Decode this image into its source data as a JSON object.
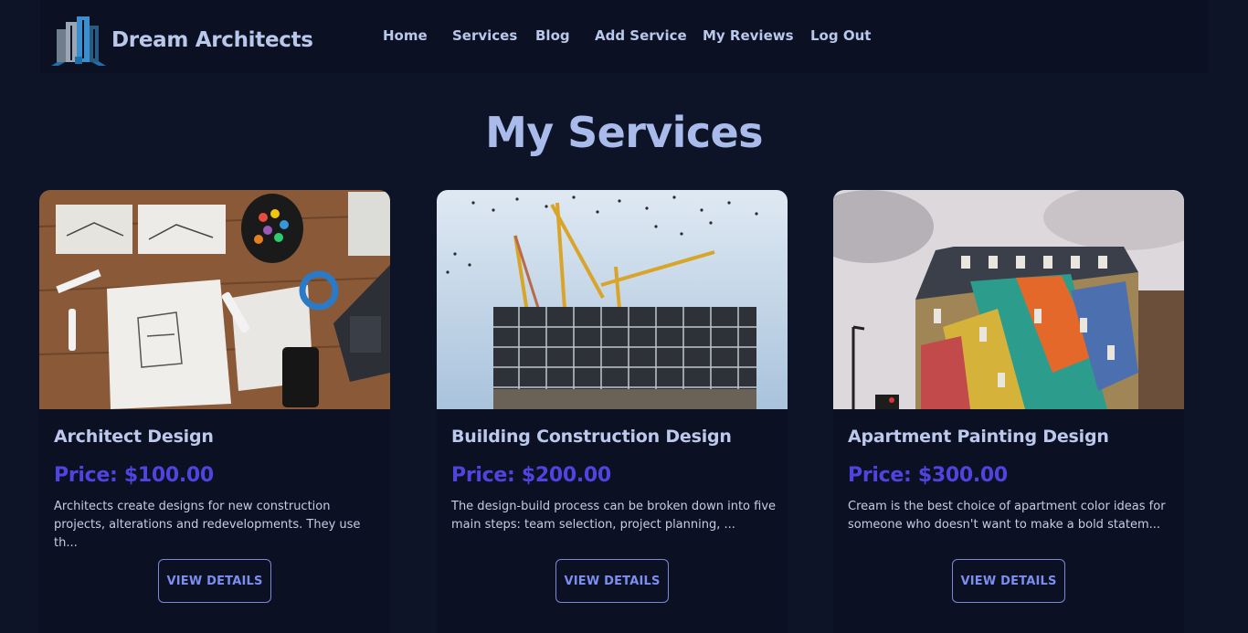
{
  "brand": {
    "name": "Dream Architects",
    "logo_icon": "building-logo-icon"
  },
  "nav": {
    "links": [
      {
        "label": "Home"
      },
      {
        "label": "Services"
      },
      {
        "label": "Blog"
      },
      {
        "label": "Add Service"
      },
      {
        "label": "My Reviews"
      },
      {
        "label": "Log Out"
      }
    ]
  },
  "page": {
    "title": "My Services"
  },
  "services": [
    {
      "title": "Architect Design",
      "price": "Price: $100.00",
      "description": "Architects create designs for new construction projects, alterations and redevelopments. They use th...",
      "button": "VIEW DETAILS"
    },
    {
      "title": "Building Construction Design",
      "price": "Price: $200.00",
      "description": "The design-build process can be broken down into five main steps: team selection, project planning, ...",
      "button": "VIEW DETAILS"
    },
    {
      "title": "Apartment Painting Design",
      "price": "Price: $300.00",
      "description": "Cream is the best choice of apartment color ideas for someone who doesn't want to make a bold statem...",
      "button": "VIEW DETAILS"
    }
  ],
  "colors": {
    "background": "#0e1427",
    "navbar": "#0b1122",
    "card": "#0b1122",
    "text": "#b9c7ea",
    "price_accent": "#5044e0",
    "button_border": "#7a88d8"
  }
}
